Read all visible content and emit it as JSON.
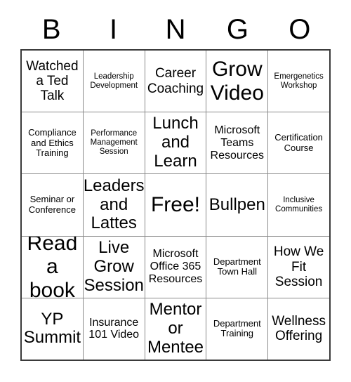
{
  "header": {
    "letters": [
      "B",
      "I",
      "N",
      "G",
      "O"
    ]
  },
  "grid": {
    "rows": [
      [
        {
          "text": "Watched a Ted Talk",
          "size": "l"
        },
        {
          "text": "Leadership Development",
          "size": "xs"
        },
        {
          "text": "Career Coaching",
          "size": "l"
        },
        {
          "text": "Grow Video",
          "size": "xxl"
        },
        {
          "text": "Emergenetics Workshop",
          "size": "xs"
        }
      ],
      [
        {
          "text": "Compliance and Ethics Training",
          "size": "s"
        },
        {
          "text": "Performance Management Session",
          "size": "xs"
        },
        {
          "text": "Lunch and Learn",
          "size": "xl"
        },
        {
          "text": "Microsoft Teams Resources",
          "size": "m"
        },
        {
          "text": "Certification Course",
          "size": "s"
        }
      ],
      [
        {
          "text": "Seminar or Conference",
          "size": "s"
        },
        {
          "text": "Leaders and Lattes",
          "size": "xl"
        },
        {
          "text": "Free!",
          "size": "xxl"
        },
        {
          "text": "Bullpen",
          "size": "xl"
        },
        {
          "text": "Inclusive Communities",
          "size": "xs"
        }
      ],
      [
        {
          "text": "Read a book",
          "size": "xxl"
        },
        {
          "text": "Live Grow Session",
          "size": "xl"
        },
        {
          "text": "Microsoft Office 365 Resources",
          "size": "m"
        },
        {
          "text": "Department Town Hall",
          "size": "s"
        },
        {
          "text": "How We Fit Session",
          "size": "l"
        }
      ],
      [
        {
          "text": "YP Summit",
          "size": "xl"
        },
        {
          "text": "Insurance 101 Video",
          "size": "m"
        },
        {
          "text": "Mentor or Mentee",
          "size": "xl"
        },
        {
          "text": "Department Training",
          "size": "s"
        },
        {
          "text": "Wellness Offering",
          "size": "l"
        }
      ]
    ]
  }
}
